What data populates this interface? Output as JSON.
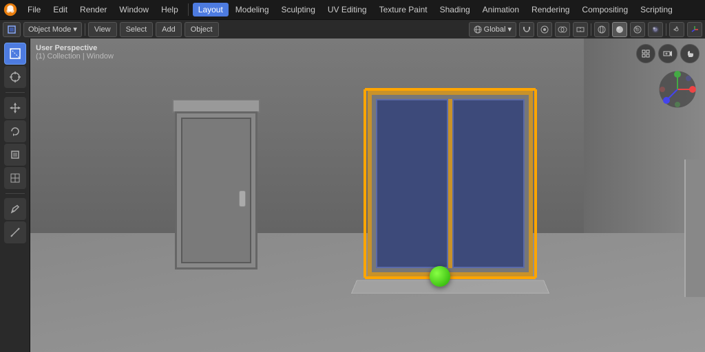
{
  "app": {
    "title": "Blender"
  },
  "topMenu": {
    "items": [
      {
        "id": "file",
        "label": "File"
      },
      {
        "id": "edit",
        "label": "Edit"
      },
      {
        "id": "render",
        "label": "Render"
      },
      {
        "id": "window",
        "label": "Window"
      },
      {
        "id": "help",
        "label": "Help"
      },
      {
        "id": "layout",
        "label": "Layout",
        "active": true
      },
      {
        "id": "modeling",
        "label": "Modeling"
      },
      {
        "id": "sculpting",
        "label": "Sculpting"
      },
      {
        "id": "uv-editing",
        "label": "UV Editing"
      },
      {
        "id": "texture-paint",
        "label": "Texture Paint"
      },
      {
        "id": "shading",
        "label": "Shading"
      },
      {
        "id": "animation",
        "label": "Animation"
      },
      {
        "id": "rendering",
        "label": "Rendering"
      },
      {
        "id": "compositing",
        "label": "Compositing"
      },
      {
        "id": "scripting",
        "label": "Scripting"
      }
    ]
  },
  "toolbarBar": {
    "objectMode": "Object Mode",
    "view": "View",
    "select": "Select",
    "add": "Add",
    "object": "Object",
    "global": "Global",
    "chevron": "▾"
  },
  "leftTools": [
    {
      "id": "select",
      "icon": "⬚",
      "active": true
    },
    {
      "id": "cursor",
      "icon": "⊕"
    },
    {
      "id": "move",
      "icon": "✛"
    },
    {
      "id": "rotate",
      "icon": "↺"
    },
    {
      "id": "scale",
      "icon": "⬜"
    },
    {
      "id": "transform",
      "icon": "⊞"
    },
    {
      "id": "annotate",
      "icon": "✏"
    },
    {
      "id": "measure",
      "icon": "📐"
    }
  ],
  "viewport": {
    "label": "User Perspective",
    "collection": "(1) Collection | Window"
  },
  "cornerButtons": [
    {
      "id": "ortho",
      "icon": "⊞"
    },
    {
      "id": "camera",
      "icon": "📷"
    },
    {
      "id": "hand",
      "icon": "✋"
    }
  ],
  "colors": {
    "active": "#4d7be0",
    "selection": "orange",
    "background": "#555555"
  }
}
